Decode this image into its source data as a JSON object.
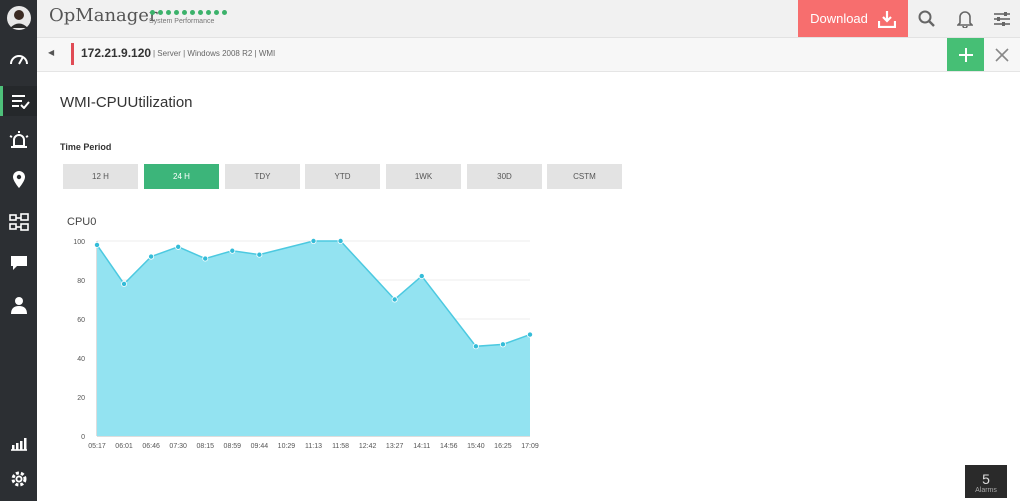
{
  "app": {
    "name": "OpManager",
    "subtitle": "System Performance"
  },
  "topbar": {
    "download_label": "Download"
  },
  "crumb": {
    "ip": "172.21.9.120",
    "meta": "| Server | Windows 2008 R2 | WMI"
  },
  "page": {
    "title": "WMI-CPUUtilization",
    "time_period_label": "Time Period"
  },
  "tabs": [
    "12 H",
    "24 H",
    "TDY",
    "YTD",
    "1WK",
    "30D",
    "CSTM"
  ],
  "active_tab": "24 H",
  "alarms": {
    "count": "5",
    "label": "Alarms"
  },
  "colors": {
    "accent": "#3cb57a",
    "download": "#f76e6e",
    "sidebar": "#2c2f33",
    "area": "#93e3f1",
    "line": "#4cc9e0"
  },
  "chart_data": {
    "type": "area",
    "title": "CPU0",
    "x": [
      "05:17",
      "06:01",
      "06:46",
      "07:30",
      "08:15",
      "08:59",
      "09:44",
      "10:29",
      "11:13",
      "11:58",
      "12:42",
      "13:27",
      "14:11",
      "14:56",
      "15:40",
      "16:25",
      "17:09"
    ],
    "series": [
      {
        "values": [
          98,
          78,
          92,
          97,
          91,
          95,
          93,
          100,
          100,
          70,
          82,
          46,
          47,
          52
        ]
      }
    ],
    "x_points": [
      "05:17",
      "06:01",
      "06:46",
      "07:30",
      "08:15",
      "08:59",
      "09:44",
      "11:13",
      "11:58",
      "13:27",
      "14:11",
      "15:40",
      "16:25",
      "17:09"
    ],
    "ylim": [
      0,
      100
    ],
    "yticks": [
      0,
      20,
      40,
      60,
      80,
      100
    ],
    "grid": true
  }
}
